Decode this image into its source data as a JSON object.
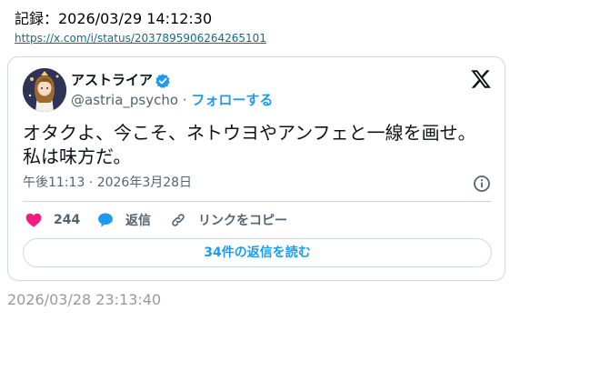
{
  "record": {
    "label": "記録：2026/03/29 14:12:30",
    "url": "https://x.com/i/status/2037895906264265101"
  },
  "tweet": {
    "author_name": "アストライア",
    "handle": "@astria_psycho",
    "separator": "·",
    "follow_label": "フォローする",
    "text_line1": "オタクよ、今こそ、ネトウヨやアンフェと一線を画せ。",
    "text_line2": "私は味方だ。",
    "time": "午後11:13 · 2026年3月28日",
    "like_count": "244",
    "reply_label": "返信",
    "copy_label": "リンクをコピー",
    "read_replies_label": "34件の返信を読む"
  },
  "saved_timestamp": "2026/03/28 23:13:40",
  "colors": {
    "accent": "#1d9bf0",
    "like": "#f91880",
    "muted_text": "#536471",
    "border": "#cfd9de",
    "link": "#1a6b7c"
  },
  "icons": {
    "verified": "verified-badge-icon",
    "x_logo": "x-logo-icon",
    "info": "info-icon",
    "like": "heart-icon",
    "reply": "speech-bubble-icon",
    "copy": "link-icon"
  }
}
